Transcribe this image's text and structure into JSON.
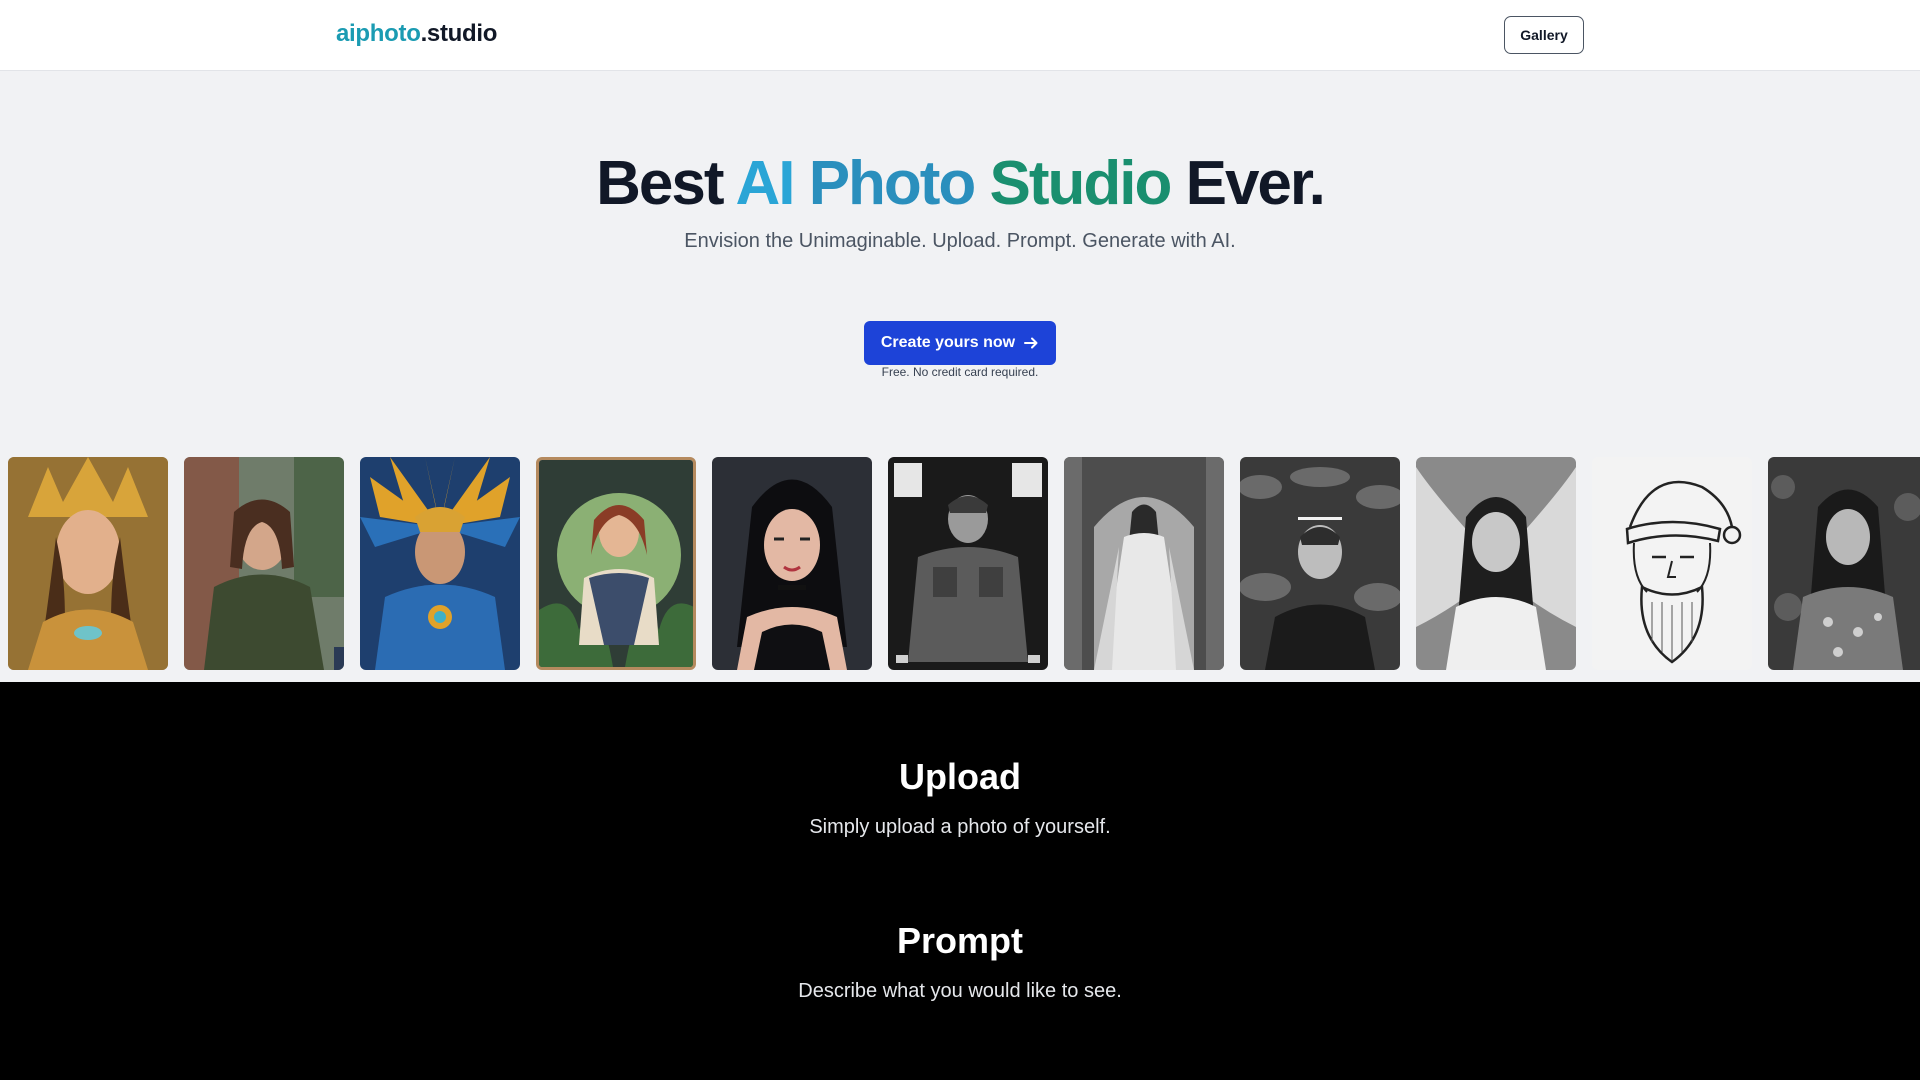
{
  "header": {
    "logo_accent": "aiphoto",
    "logo_rest": ".studio",
    "gallery_label": "Gallery"
  },
  "hero": {
    "title_before": "Best ",
    "title_g1": "AI ",
    "title_g2": "Photo ",
    "title_g3": "Studio",
    "title_after": " Ever.",
    "subtitle": "Envision the Unimaginable. Upload. Prompt. Generate with AI.",
    "cta_label": "Create yours now",
    "cta_icon": "arrow-right-icon",
    "cta_note": "Free. No credit card required."
  },
  "gallery_strip": [
    {
      "subject": "golden-goddess-portrait"
    },
    {
      "subject": "woman-city-street-portrait"
    },
    {
      "subject": "feathered-headdress-warrior"
    },
    {
      "subject": "illustrated-explorer-woman"
    },
    {
      "subject": "dark-hair-woman-portrait"
    },
    {
      "subject": "soldier-poster"
    },
    {
      "subject": "woman-in-archway"
    },
    {
      "subject": "man-in-jungle"
    },
    {
      "subject": "angel-wings-woman"
    },
    {
      "subject": "santa-line-drawing"
    },
    {
      "subject": "woman-floral-dress"
    }
  ],
  "steps": [
    {
      "title": "Upload",
      "description": "Simply upload a photo of yourself."
    },
    {
      "title": "Prompt",
      "description": "Describe what you would like to see."
    }
  ],
  "colors": {
    "brand_teal": "#1b9bb2",
    "cta_blue": "#1d43d8",
    "title_teal": "#2aa5d6",
    "title_green": "#1a8f6f"
  }
}
